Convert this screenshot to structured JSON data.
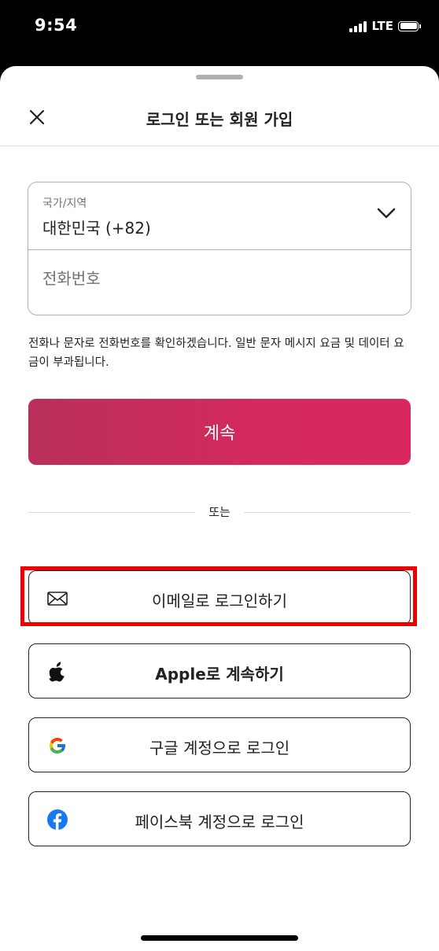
{
  "status_bar": {
    "time": "9:54",
    "network": "LTE"
  },
  "header": {
    "title": "로그인 또는 회원 가입"
  },
  "phone_form": {
    "country_label": "국가/지역",
    "country_value": "대한민국 (+82)",
    "phone_placeholder": "전화번호"
  },
  "notice": "전화나 문자로 전화번호를 확인하겠습니다. 일반 문자 메시지 요금 및 데이터 요금이 부과됩니다.",
  "continue_label": "계속",
  "divider_label": "또는",
  "social_buttons": [
    {
      "label": "이메일로 로그인하기",
      "icon": "mail-icon"
    },
    {
      "label": "Apple로 계속하기",
      "icon": "apple-icon"
    },
    {
      "label": "구글 계정으로 로그인",
      "icon": "google-icon"
    },
    {
      "label": "페이스북 계정으로 로그인",
      "icon": "facebook-icon"
    }
  ],
  "colors": {
    "accent_start": "#b9305a",
    "accent_end": "#d8285f",
    "highlight": "#ee0000",
    "facebook": "#1877f2"
  }
}
